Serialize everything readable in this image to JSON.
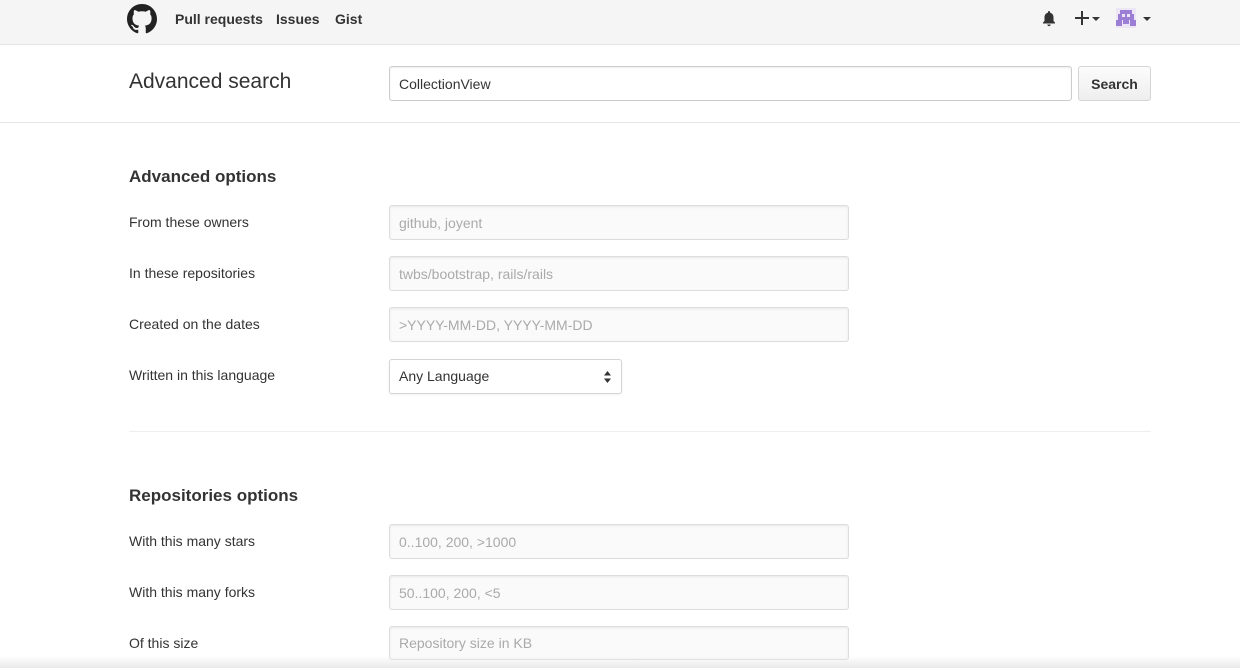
{
  "nav": {
    "links": [
      "Pull requests",
      "Issues",
      "Gist"
    ],
    "icons": {
      "logo": "github-octocat-icon",
      "notifications": "bell-icon",
      "create": "plus-icon",
      "profile": "avatar-icon"
    },
    "avatar_color": "#9b7fd4"
  },
  "search": {
    "title": "Advanced search",
    "query": "CollectionView",
    "button_label": "Search"
  },
  "advanced": {
    "title": "Advanced options",
    "owners_label": "From these owners",
    "owners_placeholder": "github, joyent",
    "repos_label": "In these repositories",
    "repos_placeholder": "twbs/bootstrap, rails/rails",
    "dates_label": "Created on the dates",
    "dates_placeholder": ">YYYY-MM-DD, YYYY-MM-DD",
    "language_label": "Written in this language",
    "language_value": "Any Language"
  },
  "repositories": {
    "title": "Repositories options",
    "stars_label": "With this many stars",
    "stars_placeholder": "0..100, 200, >1000",
    "forks_label": "With this many forks",
    "forks_placeholder": "50..100, 200, <5",
    "size_label": "Of this size",
    "size_placeholder": "Repository size in KB"
  }
}
